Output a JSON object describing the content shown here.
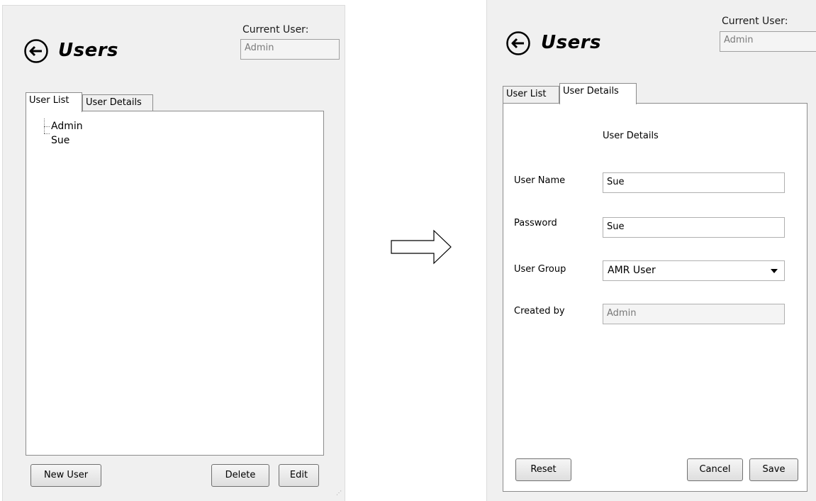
{
  "left": {
    "title": "Users",
    "current_user_label": "Current User:",
    "current_user_value": "Admin",
    "tabs": [
      "User List",
      "User Details"
    ],
    "users": [
      "Admin",
      "Sue"
    ],
    "buttons": {
      "new_user": "New User",
      "delete": "Delete",
      "edit": "Edit"
    }
  },
  "right": {
    "title": "Users",
    "current_user_label": "Current User:",
    "current_user_value": "Admin",
    "tabs": [
      "User List",
      "User Details"
    ],
    "section_heading": "User Details",
    "fields": {
      "user_name_label": "User Name",
      "user_name_value": "Sue",
      "password_label": "Password",
      "password_value": "Sue",
      "user_group_label": "User Group",
      "user_group_value": "AMR User",
      "created_by_label": "Created by",
      "created_by_value": "Admin"
    },
    "buttons": {
      "reset": "Reset",
      "cancel": "Cancel",
      "save": "Save"
    }
  },
  "icons": {
    "back": "back-arrow-circle-icon",
    "transition": "right-arrow-icon"
  }
}
